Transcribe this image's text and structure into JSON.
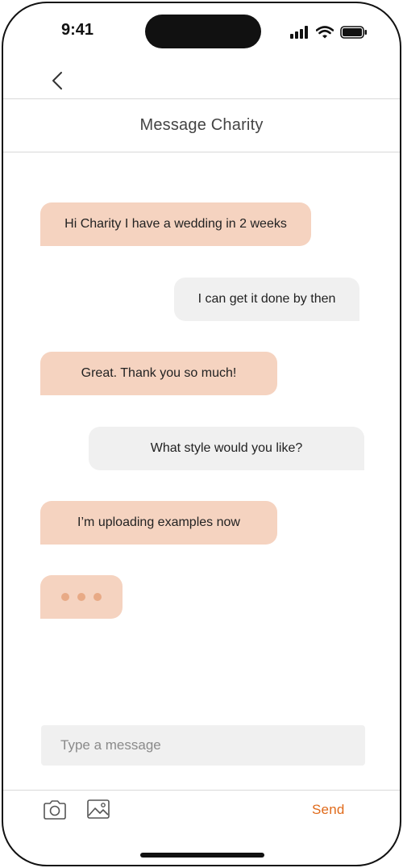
{
  "status_bar": {
    "time": "9:41"
  },
  "header": {
    "title": "Message Charity"
  },
  "messages": [
    {
      "text": "Hi Charity I have a wedding in 2 weeks",
      "sender": "user"
    },
    {
      "text": "I can get it done by then",
      "sender": "charity"
    },
    {
      "text": "Great. Thank you so much!",
      "sender": "user"
    },
    {
      "text": "What style would you like?",
      "sender": "charity"
    },
    {
      "text": "I’m uploading examples now",
      "sender": "user"
    }
  ],
  "composer": {
    "placeholder": "Type a message",
    "value": "",
    "send_label": "Send"
  },
  "icons": {
    "back": "chevron-left-icon",
    "camera": "camera-icon",
    "image": "image-icon",
    "signal": "signal-icon",
    "wifi": "wifi-icon",
    "battery": "battery-icon"
  },
  "colors": {
    "incoming_bubble": "#f5d3c0",
    "outgoing_bubble": "#f0f0f0",
    "typing_dot": "#e8aa86",
    "accent": "#e06a1a"
  }
}
